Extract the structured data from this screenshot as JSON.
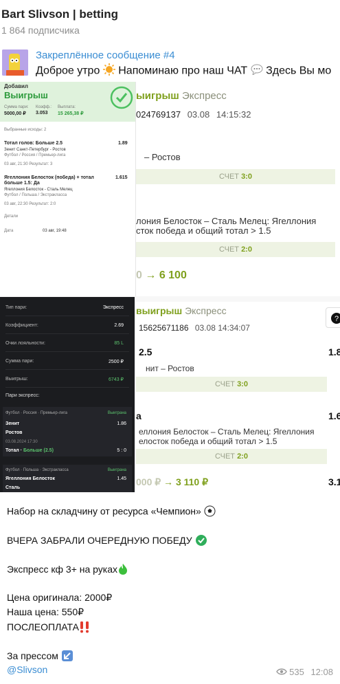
{
  "channel": {
    "title": "Bart Slivson | betting",
    "subscribers": "1 864 подписчика"
  },
  "pinned": {
    "title": "Закреплённое сообщение #4",
    "text_a": "Доброе утро",
    "text_b": "Напоминаю про наш ЧАТ",
    "text_c": "Здесь Вы мо"
  },
  "receipt_light": {
    "header_partial": "Добавил",
    "status": "Выигрыш",
    "stake_label": "Сумма пари:",
    "stake": "5000,00 ₽",
    "coef_label": "Коэфф.:",
    "coef": "3.053",
    "payout_label": "Выплата:",
    "payout": "15 265,38 ₽",
    "outcomes_label": "Выбранные исходы: 2",
    "bet1_title": "Тотал голов: Больше 2.5",
    "bet1_coef": "1.89",
    "bet1_match": "Зенит Санкт-Петербург - Ростов",
    "bet1_league": "Футбол / Россия / Премьер-лига",
    "bet1_time": "03 авг, 21:30  Результат: 3",
    "bet2_title": "Ягеллония Белосток (победа) + тотал больше 1.5: Да",
    "bet2_coef": "1.615",
    "bet2_match": "Ягеллония Белосток - Сталь Мелец",
    "bet2_league": "Футбол / Польша / Экстракласса",
    "bet2_time": "03 авг, 22:30  Результат: 2:0",
    "details_label": "Детали",
    "date_label": "Дата",
    "date": "03 авг, 19:48"
  },
  "panel_top": {
    "status": "ыигрыш",
    "type": "Экспресс",
    "bet_id": "024769137",
    "date": "03.08",
    "time": "14:15:32",
    "match1": "– Ростов",
    "score_label": "СЧЕТ",
    "score1": "3:0",
    "match2_line1": "лония Белосток – Сталь Мелец: Ягеллония",
    "match2_line2": "сток победа и общий тотал > 1.5",
    "score2": "2:0",
    "payout_from": "0",
    "payout_to": "6 100"
  },
  "panel_bottom": {
    "status": "выигрыш",
    "type": "Экспресс",
    "bet_id": "15625671186",
    "date": "03.08",
    "time": "14:34:07",
    "bet1": "2.5",
    "bet1_coef": "1.8",
    "match1": "нит – Ростов",
    "score_label": "СЧЕТ",
    "score1": "3:0",
    "bet2": "а",
    "bet2_coef": "1.6",
    "match2_line1": "еллония Белосток – Сталь Мелец: Ягеллония",
    "match2_line2": "елосток победа и общий тотал > 1.5",
    "score2": "2:0",
    "payout_from": "000 ₽",
    "payout_to": "3 110 ₽",
    "total_coef": "3.1"
  },
  "receipt_dark": {
    "rows": [
      {
        "label": "Тип пари:",
        "value": "Экспресс"
      },
      {
        "label": "Коэффициент:",
        "value": "2.69"
      },
      {
        "label": "Очки лояльности:",
        "value": "85 L"
      },
      {
        "label": "Сумма пари:",
        "value": "2500 ₽"
      },
      {
        "label": "Выигрыш:",
        "value": "6743 ₽"
      }
    ],
    "express_label": "Пари экспресс:",
    "e1_league": "Футбол · Россия · Премьер-лига",
    "e1_status": "Выиграна",
    "e1_team1": "Зенит",
    "e1_team2": "Ростов",
    "e1_coef": "1.86",
    "e1_date": "03.08.2024 17:30",
    "e1_total": "Тотал",
    "e1_pick": "Больше (2.5)",
    "e1_score": "5 : 0",
    "e2_league": "Футбол · Польша · Экстракласса",
    "e2_status": "Выиграна",
    "e2_team1": "Ягеллония Белосток",
    "e2_team2": "Сталь",
    "e2_coef": "1.45"
  },
  "message": {
    "line1": "Набор на складчину от ресурса «Чемпион»",
    "line2": "ВЧЕРА ЗАБРАЛИ ОЧЕРЕДНУЮ ПОБЕДУ",
    "line3": "Экспресс кф 3+ на руках",
    "line4": "Цена оригинала: 2000₽",
    "line5": "Наша цена: 550₽",
    "line6": "ПОСЛЕОПЛАТА",
    "line7": "За прессом",
    "link": "@Slivson"
  },
  "meta": {
    "views": "535",
    "time": "12:08"
  },
  "colors": {
    "accent_blue": "#3a8dd3",
    "win_green": "#7fa01d",
    "check_green": "#2fae5b"
  }
}
